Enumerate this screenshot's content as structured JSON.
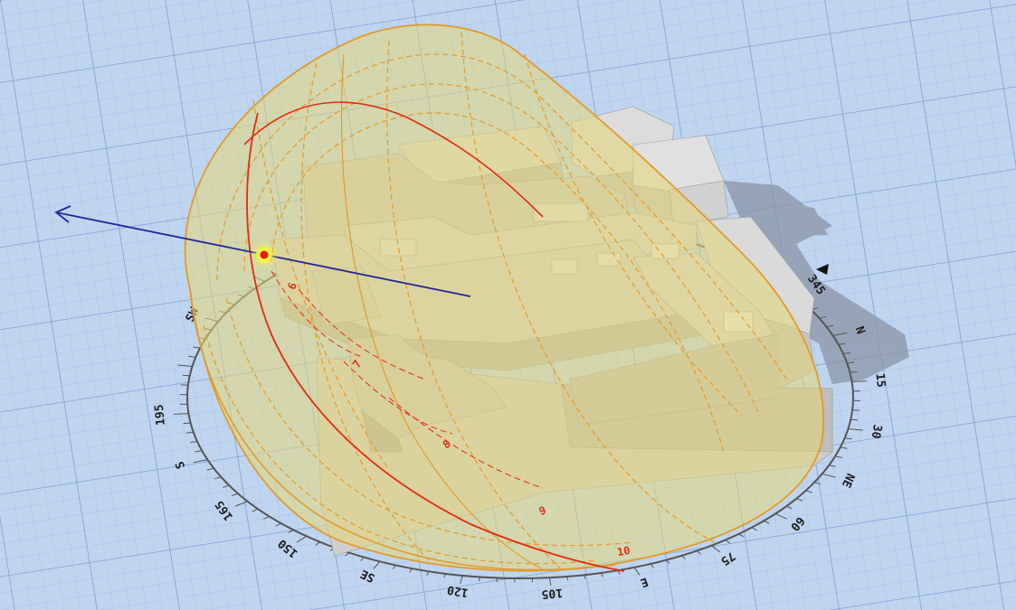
{
  "compass": {
    "labels": [
      {
        "text": "N",
        "angle": 0
      },
      {
        "text": "15",
        "angle": 15
      },
      {
        "text": "30",
        "angle": 30
      },
      {
        "text": "NE",
        "angle": 45
      },
      {
        "text": "60",
        "angle": 60
      },
      {
        "text": "75",
        "angle": 75
      },
      {
        "text": "E",
        "angle": 90
      },
      {
        "text": "105",
        "angle": 105
      },
      {
        "text": "120",
        "angle": 120
      },
      {
        "text": "SE",
        "angle": 135
      },
      {
        "text": "150",
        "angle": 150
      },
      {
        "text": "165",
        "angle": 165
      },
      {
        "text": "S",
        "angle": 180
      },
      {
        "text": "345",
        "angle": 345
      },
      {
        "text": "SW",
        "angle": 225
      },
      {
        "text": "195",
        "angle": 195
      }
    ]
  },
  "sun_path": {
    "hour_labels": [
      "6",
      "7",
      "8",
      "9",
      "10"
    ]
  },
  "colors": {
    "ground": "#bcd3ee",
    "grid_minor": "#9fbde3",
    "grid_major": "#7fa4d4",
    "dome_fill": "#e8d87a",
    "dome_edge": "#e39a2a",
    "sun_path": "#e52a10",
    "sun_vector": "#22269a",
    "sun_glow": "#f4f03a",
    "building": "#c8c8c8"
  }
}
